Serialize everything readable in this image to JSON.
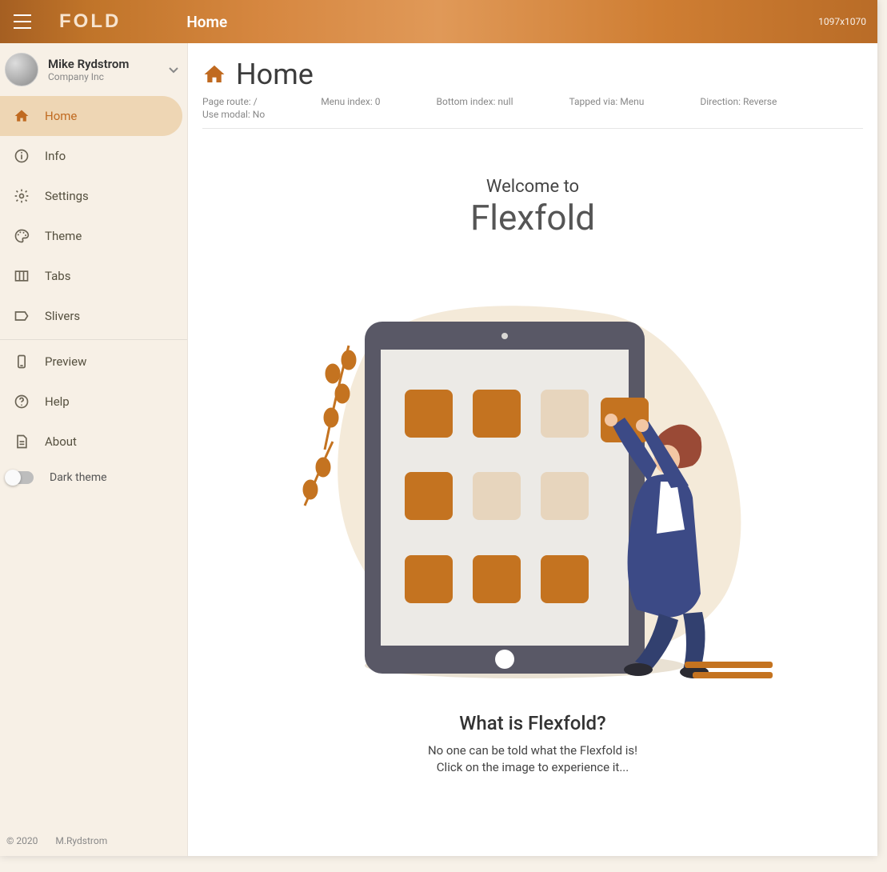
{
  "appbar": {
    "logo": "FOLD",
    "title": "Home",
    "dims": "1097x1070"
  },
  "user": {
    "name": "Mike Rydstrom",
    "company": "Company Inc"
  },
  "sidebar": {
    "items": [
      {
        "label": "Home",
        "icon": "home-icon",
        "active": true
      },
      {
        "label": "Info",
        "icon": "info-icon",
        "active": false
      },
      {
        "label": "Settings",
        "icon": "settings-icon",
        "active": false
      },
      {
        "label": "Theme",
        "icon": "palette-icon",
        "active": false
      },
      {
        "label": "Tabs",
        "icon": "columns-icon",
        "active": false
      },
      {
        "label": "Slivers",
        "icon": "tag-icon",
        "active": false
      }
    ],
    "items2": [
      {
        "label": "Preview",
        "icon": "phone-icon"
      },
      {
        "label": "Help",
        "icon": "help-icon"
      },
      {
        "label": "About",
        "icon": "doc-icon"
      }
    ],
    "dark_theme_label": "Dark theme",
    "dark_theme_on": false,
    "footer_left": "© 2020",
    "footer_right": "M.Rydstrom"
  },
  "page": {
    "title": "Home",
    "debug": {
      "page_route": "Page route: /",
      "use_modal": "Use modal: No",
      "menu_index": "Menu index: 0",
      "bottom_index": "Bottom index: null",
      "tapped_via": "Tapped via: Menu",
      "direction": "Direction: Reverse"
    },
    "welcome_small": "Welcome to",
    "welcome_big": "Flexfold",
    "what_title": "What is Flexfold?",
    "what_line1": "No one can be told what the Flexfold is!",
    "what_line2": "Click on the image to experience it..."
  },
  "colors": {
    "accent": "#c06a20",
    "accent_light": "#eed6b4",
    "tile_dark": "#c47320",
    "tile_light": "#e7d5bd",
    "tablet": "#595866"
  }
}
